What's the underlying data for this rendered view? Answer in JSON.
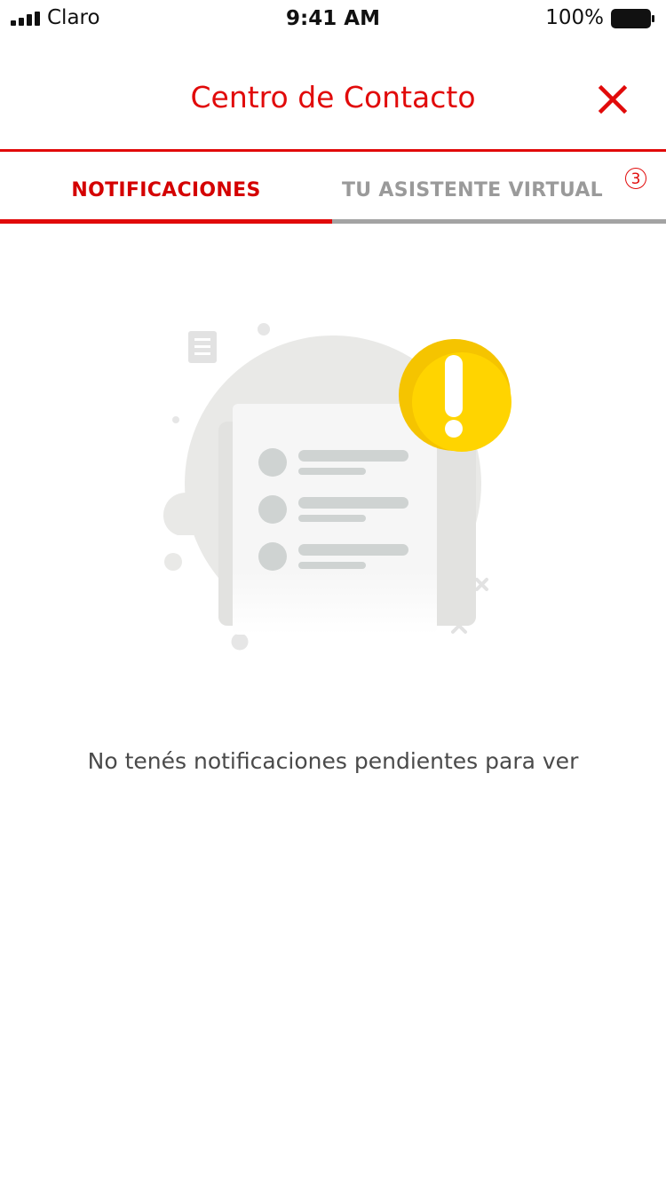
{
  "status_bar": {
    "carrier": "Claro",
    "time": "9:41 AM",
    "battery": "100%"
  },
  "header": {
    "title": "Centro de Contacto",
    "close_icon": "close-x-icon"
  },
  "tabs": [
    {
      "label": "NOTIFICACIONES",
      "active": true
    },
    {
      "label": "TU ASISTENTE VIRTUAL",
      "active": false,
      "badge": "3"
    }
  ],
  "empty_state": {
    "illustration_icon": "empty-notifications-illustration",
    "message": "No tenés notificaciones pendientes para ver"
  },
  "colors": {
    "accent": "#e10a0a",
    "inactive": "#9a9a9a",
    "alert": "#f5c400"
  }
}
